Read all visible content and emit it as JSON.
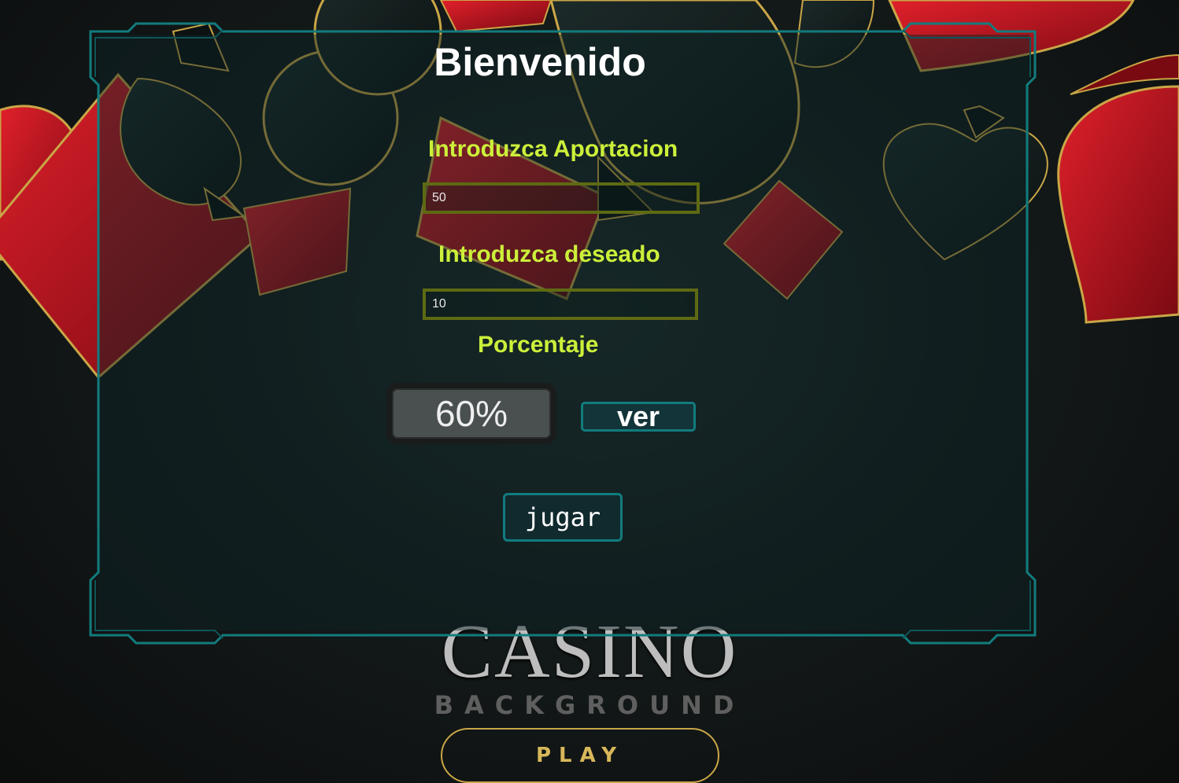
{
  "background": {
    "casino_title": "CASINO",
    "casino_subtitle": "BACKGROUND",
    "play_label": "PLAY"
  },
  "panel": {
    "title": "Bienvenido",
    "aportacion_label": "Introduzca Aportacion",
    "aportacion_value": "50",
    "deseado_label": "Introduzca deseado",
    "deseado_value": "10",
    "porcentaje_label": "Porcentaje",
    "porcentaje_value": "60%",
    "ver_label": "ver",
    "jugar_label": "jugar"
  },
  "colors": {
    "label": "#ccf03a",
    "panel_border": "#127c7e",
    "heart_red": "#b50f1c",
    "suit_gold": "#c9a646"
  }
}
